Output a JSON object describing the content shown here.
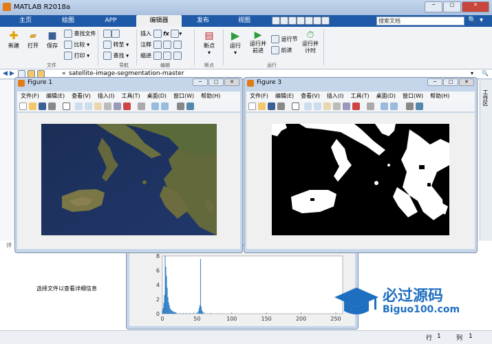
{
  "app": {
    "title": "MATLAB R2018a",
    "search_placeholder": "搜索文档"
  },
  "tabs": [
    {
      "label": "主页"
    },
    {
      "label": "绘图"
    },
    {
      "label": "APP"
    },
    {
      "label": "编辑器"
    },
    {
      "label": "发布"
    },
    {
      "label": "视图"
    }
  ],
  "ribbon": {
    "file": {
      "new": "新建",
      "open": "打开",
      "save": "保存",
      "find_files": "查找文件",
      "compare": "比较",
      "print": "打印",
      "group": "文件"
    },
    "nav": {
      "goto": "转至",
      "find": "查找",
      "group": "导航"
    },
    "edit": {
      "insert": "插入",
      "comment": "注释",
      "indent": "缩进",
      "fx": "fx",
      "group": "编辑"
    },
    "breakpoints": {
      "label": "断点",
      "group": "断点"
    },
    "run": {
      "run": "运行",
      "run_advance": "运行并前进",
      "run_section": "运行节",
      "advance": "前进",
      "run_time": "运行并计时",
      "group": "运行"
    }
  },
  "address": {
    "path": "satellite-image-segmentation-master"
  },
  "figure1": {
    "title": "Figure 1",
    "menus": [
      "文件(F)",
      "编辑(E)",
      "查看(V)",
      "插入(I)",
      "工具(T)",
      "桌面(D)",
      "窗口(W)",
      "帮助(H)"
    ]
  },
  "figure3": {
    "title": "Figure 3",
    "menus": [
      "文件(F)",
      "编辑(E)",
      "查看(V)",
      "插入(I)",
      "工具(T)",
      "桌面(D)",
      "窗口(W)",
      "帮助(H)"
    ]
  },
  "left_panel": {
    "detail_label": "详",
    "hint": "选择文件以查看详细信息"
  },
  "histogram": {
    "y_top": "8",
    "y_ticks": [
      "6",
      "4",
      "2",
      "0"
    ],
    "x_ticks": [
      "0",
      "50",
      "100",
      "150",
      "200",
      "250"
    ]
  },
  "watermark": {
    "text_cn": "必过源码",
    "text_url": "Biguo100.com"
  },
  "statusbar": {
    "row_label": "行",
    "row": "1",
    "col_label": "列",
    "col": "1"
  },
  "side_label": "工作区",
  "colors": {
    "tab_bar": "#1f5aa8",
    "title_bar": "#bcd0ea"
  },
  "chart_data": {
    "type": "bar",
    "ylim": [
      0,
      8
    ],
    "xlim": [
      0,
      260
    ],
    "x": [
      0,
      1,
      2,
      3,
      4,
      5,
      6,
      7,
      8,
      9,
      10,
      11,
      12,
      13,
      14,
      15,
      16,
      17,
      18,
      19,
      20,
      25,
      30,
      35,
      40,
      45,
      50,
      52,
      53,
      54,
      55,
      56,
      57,
      58,
      60,
      70,
      80,
      100,
      150,
      200,
      250
    ],
    "values": [
      0.4,
      0.8,
      1.5,
      2.6,
      8.0,
      6.5,
      5.2,
      3.6,
      2.3,
      1.6,
      1.2,
      0.8,
      0.6,
      0.5,
      0.4,
      0.35,
      0.3,
      0.25,
      0.2,
      0.2,
      0.15,
      0.1,
      0.1,
      0.1,
      0.1,
      0.15,
      0.25,
      0.4,
      0.8,
      1.2,
      7.6,
      1.0,
      0.5,
      0.3,
      0.2,
      0.1,
      0.05,
      0.05,
      0.03,
      0.03,
      0.03
    ]
  }
}
